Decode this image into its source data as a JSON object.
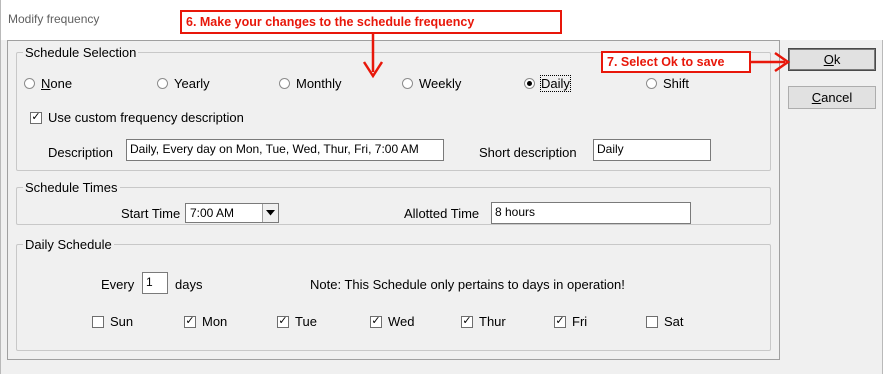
{
  "window": {
    "title": "Modify frequency"
  },
  "annotations": {
    "step6": "6. Make your changes to the schedule frequency",
    "step7": "7. Select Ok to save",
    "color": "#e8170a"
  },
  "buttons": {
    "ok": "Ok",
    "cancel": "Cancel"
  },
  "schedule_selection": {
    "legend": "Schedule Selection",
    "options": [
      {
        "label": "None",
        "selected": false
      },
      {
        "label": "Yearly",
        "selected": false
      },
      {
        "label": "Monthly",
        "selected": false
      },
      {
        "label": "Weekly",
        "selected": false
      },
      {
        "label": "Daily",
        "selected": true
      },
      {
        "label": "Shift",
        "selected": false
      }
    ],
    "custom_description": {
      "label": "Use custom frequency description",
      "checked": true
    },
    "description_label": "Description",
    "description_value": "Daily, Every day on Mon, Tue, Wed, Thur, Fri, 7:00 AM",
    "short_description_label": "Short description",
    "short_description_value": "Daily"
  },
  "schedule_times": {
    "legend": "Schedule Times",
    "start_time_label": "Start Time",
    "start_time_value": "7:00 AM",
    "allotted_time_label": "Allotted Time",
    "allotted_time_value": "8 hours"
  },
  "daily_schedule": {
    "legend": "Daily Schedule",
    "every_label": "Every",
    "every_value": "1",
    "days_label": "days",
    "note": "Note: This Schedule only pertains to days in operation!",
    "days": [
      {
        "label": "Sun",
        "checked": false
      },
      {
        "label": "Mon",
        "checked": true
      },
      {
        "label": "Tue",
        "checked": true
      },
      {
        "label": "Wed",
        "checked": true
      },
      {
        "label": "Thur",
        "checked": true
      },
      {
        "label": "Fri",
        "checked": true
      },
      {
        "label": "Sat",
        "checked": false
      }
    ]
  }
}
